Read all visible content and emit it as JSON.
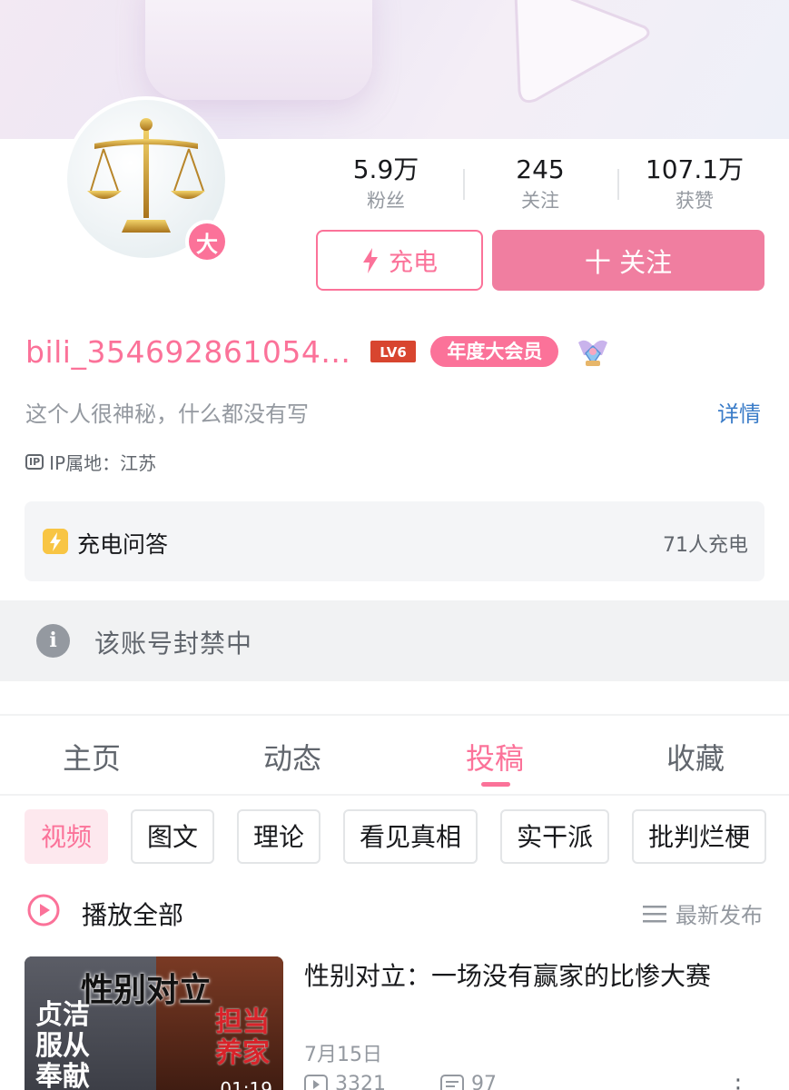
{
  "profile": {
    "avatar_badge": "大",
    "username": "bili_354692861054...",
    "level": "LV6",
    "vip_label": "年度大会员",
    "bio": "这个人很神秘，什么都没有写",
    "detail_link": "详情",
    "ip_icon": "IP",
    "ip_location": "IP属地：江苏"
  },
  "stats": [
    {
      "value": "5.9万",
      "label": "粉丝"
    },
    {
      "value": "245",
      "label": "关注"
    },
    {
      "value": "107.1万",
      "label": "获赞"
    }
  ],
  "actions": {
    "charge_label": "充电",
    "follow_label": "十 关注"
  },
  "charge_qa": {
    "title": "充电问答",
    "count": "71人充电"
  },
  "banned_notice": "该账号封禁中",
  "tabs": [
    {
      "label": "主页"
    },
    {
      "label": "动态"
    },
    {
      "label": "投稿",
      "active": true
    },
    {
      "label": "收藏"
    }
  ],
  "chips": [
    "视频",
    "图文",
    "理论",
    "看见真相",
    "实干派",
    "批判烂梗"
  ],
  "play_all": "播放全部",
  "sort_label": "最新发布",
  "video": {
    "thumb_title": "性别对立",
    "thumb_left": "贞洁\n服从\n奉献",
    "thumb_right": "担当\n养家",
    "duration": "01:19",
    "title": "性别对立：一场没有赢家的比惨大赛",
    "date": "7月15日",
    "plays": "3321",
    "comments": "97"
  },
  "colors": {
    "accent": "#fb7299",
    "link": "#3a7cc8",
    "banned_bg": "#f1f2f3"
  },
  "icons": [
    "lightning-icon",
    "play-circle-icon",
    "sort-list-icon",
    "info-icon",
    "scale-avatar",
    "medal-icon",
    "more-icon",
    "play-count-icon",
    "comment-icon"
  ]
}
